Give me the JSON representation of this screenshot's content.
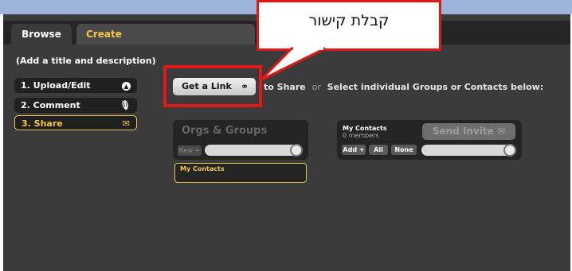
{
  "tabs": {
    "browse": "Browse",
    "create": "Create"
  },
  "subtitle": "(Add a title and description)",
  "steps": [
    {
      "label": "1. Upload/Edit",
      "icon": "upload-icon"
    },
    {
      "label": "2. Comment",
      "icon": "microphone-icon"
    },
    {
      "label": "3. Share",
      "icon": "envelope-icon"
    }
  ],
  "get_link": {
    "label": "Get a Link",
    "icon": "link-icon"
  },
  "share_instructions": {
    "text1": "to Share",
    "or": "or",
    "text2": "Select individual Groups or Contacts below:"
  },
  "orgs": {
    "title": "Orgs & Groups",
    "new_button": "New +",
    "list_item": "My Contacts"
  },
  "contacts": {
    "title": "My Contacts",
    "count": "0 members",
    "send_invite": "Send Invite",
    "add_button": "Add +",
    "all_button": "All",
    "none_button": "None"
  },
  "callout": {
    "text": "קבלת קישור"
  },
  "colors": {
    "accent": "#f3c64a",
    "highlight": "#e01818",
    "app_bg": "#3b3b3b",
    "panel_bg": "#242424"
  }
}
